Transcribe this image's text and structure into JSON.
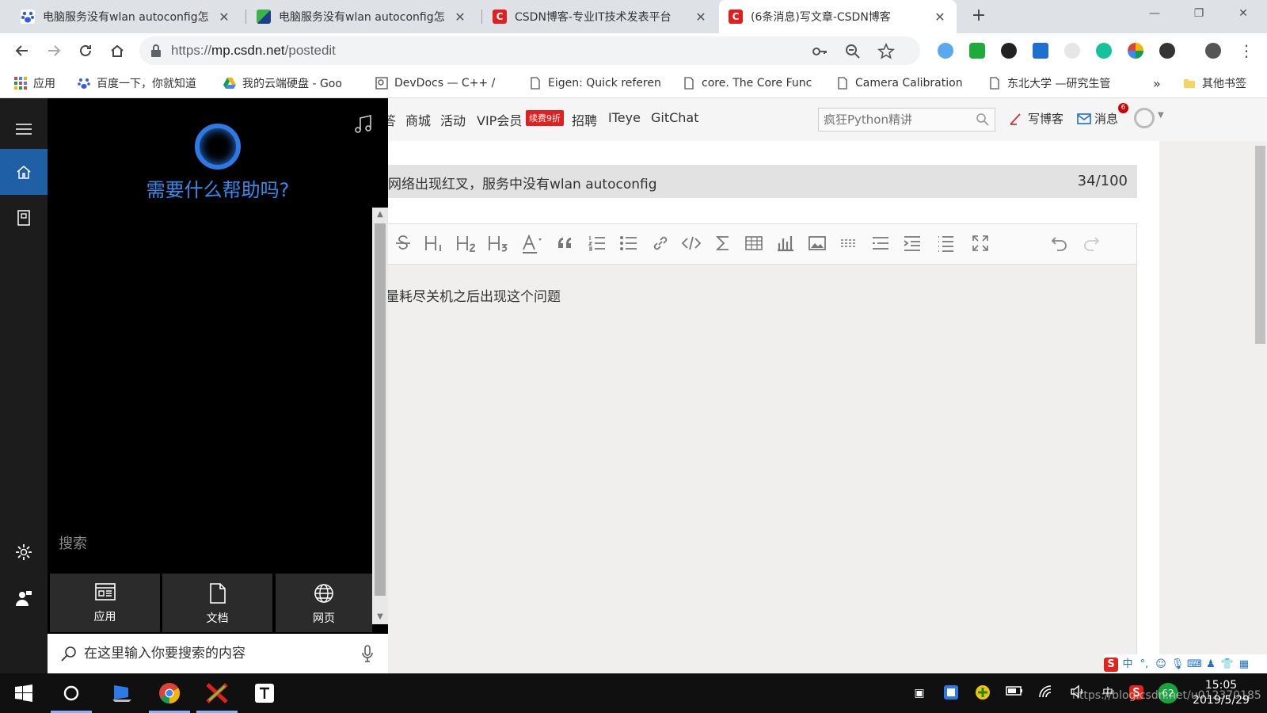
{
  "browser": {
    "tabs": [
      {
        "title": "电脑服务没有wlan autoconfig怎",
        "favicon": "baidu-paw-icon",
        "color": "#2f5de0"
      },
      {
        "title": "电脑服务没有wlan autoconfig怎",
        "favicon": "tab-green-blue-icon",
        "color": "#3bb54a"
      },
      {
        "title": "CSDN博客-专业IT技术发表平台",
        "favicon": "csdn-c-icon",
        "color": "#e02020"
      },
      {
        "title": "(6条消息)写文章-CSDN博客",
        "favicon": "csdn-c-icon",
        "color": "#e02020"
      }
    ],
    "close_glyph": "✕",
    "new_tab_glyph": "+",
    "window_controls": {
      "minimize": "—",
      "restore": "❐",
      "close": "✕"
    },
    "url": {
      "scheme": "https://",
      "host": "mp.csdn.net",
      "path": "/postedit"
    },
    "bookmarks": [
      {
        "label": "应用",
        "icon": "apps-grid-icon"
      },
      {
        "label": "百度一下，你就知道",
        "icon": "baidu-paw-icon"
      },
      {
        "label": "我的云端硬盘 - Goo",
        "icon": "google-drive-icon"
      },
      {
        "label": "DevDocs — C++ /",
        "icon": "devdocs-icon"
      },
      {
        "label": "Eigen: Quick referen",
        "icon": "page-icon"
      },
      {
        "label": "core. The Core Func",
        "icon": "page-icon"
      },
      {
        "label": "Camera Calibration",
        "icon": "page-icon"
      },
      {
        "label": "东北大学 —研究生管",
        "icon": "page-icon"
      }
    ],
    "bookmarks_more": "»",
    "other_bookmarks": "其他书签"
  },
  "csdn": {
    "nav": [
      "答",
      "商城",
      "活动",
      "VIP会员",
      "招聘",
      "ITeye",
      "GitChat"
    ],
    "vip_badge": "续费9折",
    "search_placeholder": "疯狂Python精讲",
    "write_blog": "写博客",
    "messages": "消息",
    "message_count": "6",
    "article_title": "网络出现红叉，服务中没有wlan autoconfig",
    "title_count": "34/100",
    "body_text": "量耗尽关机之后出现这个问题"
  },
  "cortana": {
    "greeting": "需要什么帮助吗?",
    "search_label": "搜索",
    "tiles": [
      {
        "label": "应用",
        "icon": "apps-window-icon"
      },
      {
        "label": "文档",
        "icon": "document-icon"
      },
      {
        "label": "网页",
        "icon": "globe-icon"
      }
    ],
    "input_placeholder": "在这里输入你要搜索的内容"
  },
  "ime": {
    "mode": "中",
    "punct": "°,"
  },
  "taskbar": {
    "time": "15:05",
    "date": "2019/5/29",
    "ime_label": "中",
    "badge_number": "62",
    "watermark": "https://blog.csdn.net/u012370185"
  },
  "colors": {
    "cortana_blue": "#2e8ded",
    "rail_selected": "#1f5fa6",
    "csdn_red": "#e02020"
  }
}
